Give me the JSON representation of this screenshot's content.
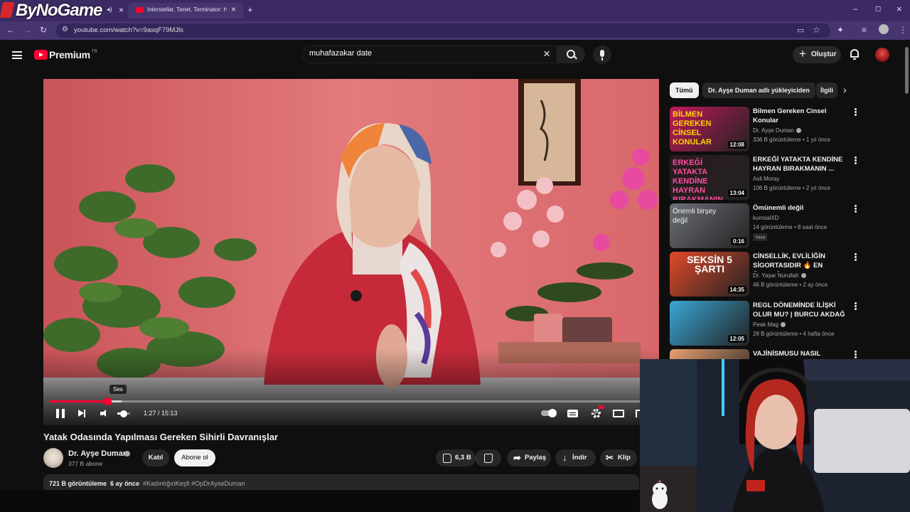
{
  "browser": {
    "logo_text": "ByNoGame",
    "tab_title": "Interstellar, Tenet, Terminator: H",
    "new_tab": "+",
    "url": "youtube.com/watch?v=9asqF79MJls",
    "window_controls": [
      "–",
      "◻",
      "×"
    ]
  },
  "header": {
    "brand": "Premium",
    "region": "TR",
    "search_value": "muhafazakar date",
    "create_label": "Oluştur"
  },
  "player": {
    "tooltip": "Ses",
    "time": "1:27 / 15:13",
    "progress_fraction": 0.096,
    "buffered_fraction": 0.12,
    "volume_fraction": 0.5,
    "accent": "#ff0033"
  },
  "video": {
    "title": "Yatak Odasında Yapılması Gereken Sihirli Davranışlar",
    "channel": "Dr. Ayşe Duman",
    "subscribers": "377 B abone",
    "join_label": "Katıl",
    "subscribe_label": "Abone ol",
    "likes": "6,3 B",
    "share_label": "Paylaş",
    "download_label": "İndir",
    "clip_label": "Klip",
    "views": "721 B görüntüleme",
    "age": "6 ay önce",
    "tags": "#KadınlığınKeşfi #OpDrAyseDuman"
  },
  "chips": [
    "Tümü",
    "Dr. Ayşe Duman adlı yükleyiciden",
    "İlgili"
  ],
  "recommendations": [
    {
      "title": "Bilmen Gereken Cinsel Konular",
      "channel": "Dr. Ayşe Duman",
      "verified": true,
      "meta": "336 B görüntüleme • 1 yıl önce",
      "duration": "12:08",
      "thumb_text": "BİLMEN GEREKEN CİNSEL KONULAR",
      "thumb_color": "#c2185b"
    },
    {
      "title": "ERKEĞİ YATAKTA KENDİNE HAYRAN BIRAKMANIN ...",
      "channel": "Asli Moray",
      "verified": false,
      "meta": "106 B görüntüleme • 2 yıl önce",
      "duration": "13:04",
      "thumb_text": "ERKEĞİ YATAKTA KENDİNE HAYRAN BIRAKMANIN YOLLARI",
      "thumb_color": "#2a1a1f"
    },
    {
      "title": "Ömünemli değil",
      "channel": "kumsalXD",
      "verified": false,
      "meta": "14 görüntüleme • 8 saat önce",
      "badge": "Yeni",
      "duration": "0:16",
      "thumb_text": "Önemli birşey değil",
      "thumb_color": "#6d7078"
    },
    {
      "title": "CİNSELLİK, EVLİLİĞİN SİGORTASIDIR 🔥 EN ÖNEMLİ ...",
      "channel": "Dr. Yaşar Nurullah",
      "verified": true,
      "meta": "46 B görüntüleme • 2 ay önce",
      "duration": "14:35",
      "thumb_text": "SEKSİN 5 ŞARTI",
      "thumb_color": "#e04a2a"
    },
    {
      "title": "REGL DÖNEMİNDE İLİŞKİ OLUR MU? | BURCU AKDAĞ ...",
      "channel": "Peak Mag",
      "verified": true,
      "meta": "28 B görüntüleme • 4 hafta önce",
      "duration": "12:05",
      "thumb_text": "",
      "thumb_color": "#3aa7d6"
    },
    {
      "title": "VAJİNİSMUSU NASIL YENDİM?",
      "channel": "",
      "verified": false,
      "meta": "",
      "duration": "",
      "thumb_text": "",
      "thumb_color": "#e8a070"
    }
  ]
}
